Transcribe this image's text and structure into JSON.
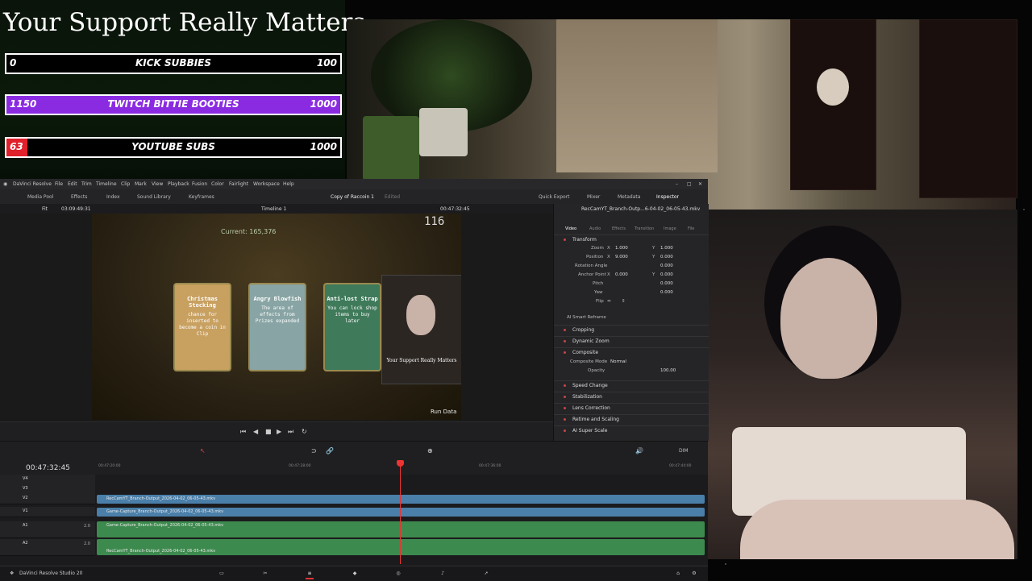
{
  "overlay": {
    "title": "Your Support Really Matters",
    "goals": [
      {
        "current": "0",
        "label": "KICK SUBBIES",
        "max": "100",
        "progress": 0.0,
        "color": "#000000"
      },
      {
        "current": "1150",
        "label": "TWITCH BITTIE BOOTIES",
        "max": "1000",
        "progress": 1.0,
        "color": "#8a2be2"
      },
      {
        "current": "63",
        "label": "YOUTUBE SUBS",
        "max": "1000",
        "progress": 0.063,
        "color": "#e0202a"
      }
    ]
  },
  "resolve": {
    "app_name": "DaVinci Resolve",
    "menu": [
      "File",
      "Edit",
      "Trim",
      "Timeline",
      "Clip",
      "Mark",
      "View",
      "Playback",
      "Fusion",
      "Color",
      "Fairlight",
      "Workspace",
      "Help"
    ],
    "toolbar_left": [
      "Media Pool",
      "Effects",
      "Index",
      "Sound Library",
      "Keyframes"
    ],
    "project_title": "Copy of Raccoin 1",
    "project_status": "Edited",
    "toolbar_right": [
      "Quick Export",
      "Mixer",
      "Metadata",
      "Inspector"
    ],
    "viewer": {
      "fit": "Fit",
      "source_timecode": "03:09:49:31",
      "timeline_name": "Timeline 1",
      "timecode": "00:47:32:45"
    },
    "game": {
      "score": "116",
      "banner": "Current: 165,376",
      "bottom_right": "Run Data",
      "cards": [
        {
          "title": "Christmas Stocking",
          "desc": "chance for inserted to become a coin in Clip",
          "color": "#c8a060"
        },
        {
          "title": "Angry Blowfish",
          "desc": "The area of effects from Prizes expanded",
          "color": "#88a4a4"
        },
        {
          "title": "Anti-lost Strap",
          "desc": "You can lock shop items to buy later",
          "color": "#3f7a5a"
        }
      ],
      "mini_overlay_title": "Your Support Really Matters"
    },
    "inspector": {
      "file_name": "RecCamYT_Branch-Outp...6-04-02_06-05-43.mkv",
      "tabs": [
        "Video",
        "Audio",
        "Effects",
        "Transition",
        "Image",
        "File"
      ],
      "transform_title": "Transform",
      "rows": [
        {
          "label": "Zoom",
          "a_axis": "X",
          "a": "1.000",
          "b_axis": "Y",
          "b": "1.000"
        },
        {
          "label": "Position",
          "a_axis": "X",
          "a": "9.000",
          "b_axis": "Y",
          "b": "0.000"
        },
        {
          "label": "Rotation Angle",
          "b": "0.000"
        },
        {
          "label": "Anchor Point",
          "a_axis": "X",
          "a": "0.000",
          "b_axis": "Y",
          "b": "0.000"
        },
        {
          "label": "Pitch",
          "b": "0.000"
        },
        {
          "label": "Yaw",
          "b": "0.000"
        },
        {
          "label": "Flip"
        }
      ],
      "smart_reframe": "AI Smart Reframe",
      "sections_a": [
        "Cropping",
        "Dynamic Zoom",
        "Composite"
      ],
      "composite_mode_label": "Composite Mode",
      "composite_mode_value": "Normal",
      "opacity_label": "Opacity",
      "opacity_value": "100.00",
      "sections_b": [
        "Speed Change",
        "Stabilization",
        "Lens Correction",
        "Retime and Scaling",
        "AI Super Scale"
      ]
    },
    "timeline": {
      "timecode": "00:47:32:45",
      "ruler": [
        "00:47:20:00",
        "00:47:28:00",
        "00:47:36:00",
        "00:47:44:00"
      ],
      "tracks": [
        {
          "name": "V4",
          "type": "video"
        },
        {
          "name": "V3",
          "type": "video"
        },
        {
          "name": "V2",
          "type": "video",
          "clip": "RecCamYT_Branch-Output_2026-04-02_06-05-43.mkv"
        },
        {
          "name": "V1",
          "type": "video",
          "clip": "Game-Capture_Branch-Output_2026-04-02_06-05-43.mkv"
        },
        {
          "name": "A1",
          "type": "audio",
          "level": "2.0",
          "clip": "Game-Capture_Branch-Output_2026-04-02_06-05-43.mkv"
        },
        {
          "name": "A2",
          "type": "audio",
          "level": "2.0",
          "clip": "RecCamYT_Branch-Output_2026-04-02_06-05-43.mkv"
        }
      ],
      "dim_label": "DIM"
    },
    "status_app": "DaVinci Resolve Studio 20"
  },
  "colors": {
    "video_clip": "#4a7fa9",
    "audio_clip": "#3d8a4e",
    "playhead": "#e33333",
    "goal_border": "#ffffff"
  }
}
